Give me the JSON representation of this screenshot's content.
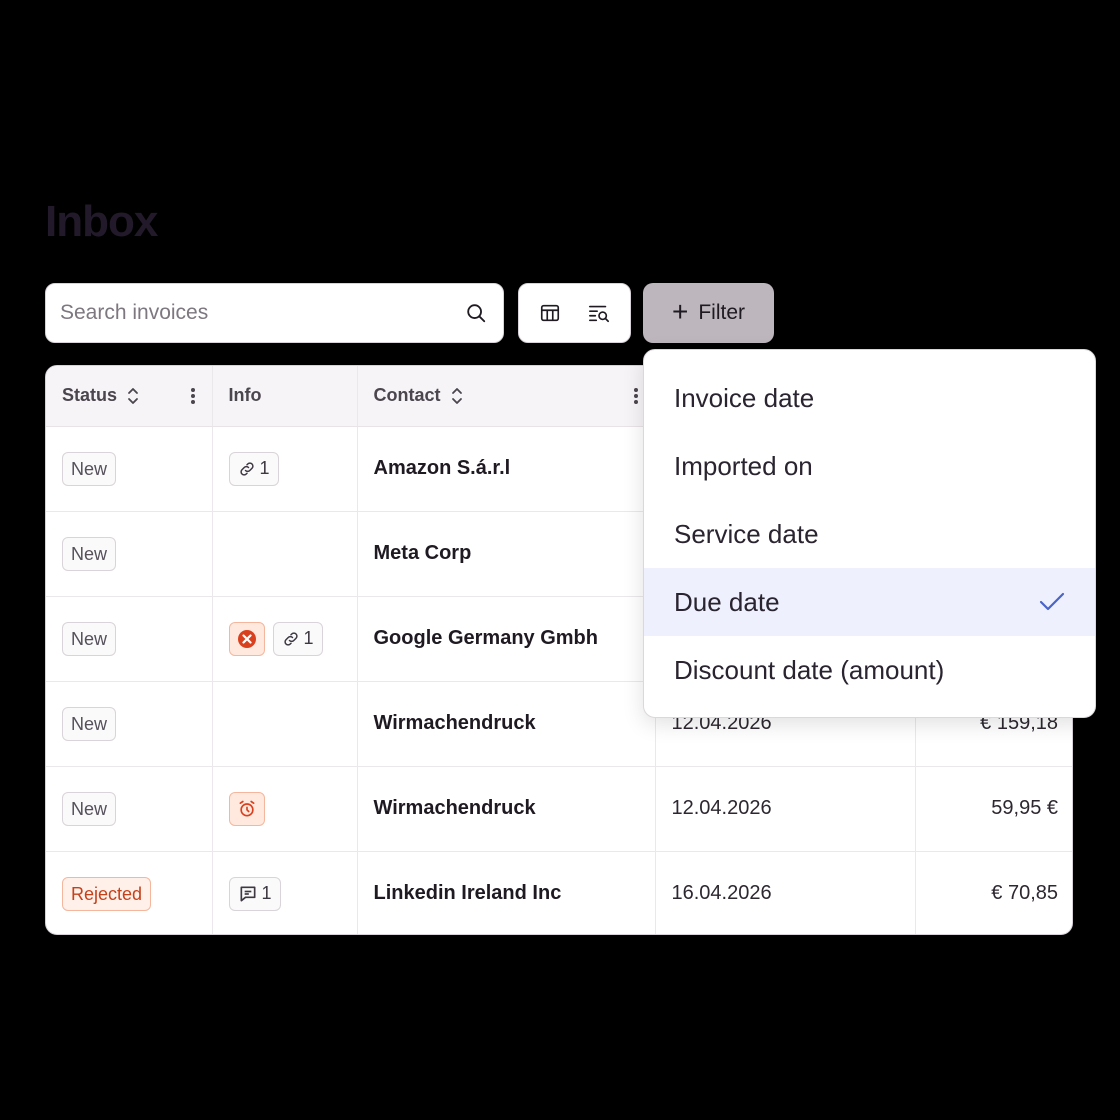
{
  "page": {
    "title": "Inbox"
  },
  "search": {
    "placeholder": "Search invoices"
  },
  "filter": {
    "label": "Filter"
  },
  "table": {
    "headers": {
      "status": "Status",
      "info": "Info",
      "contact": "Contact"
    },
    "rows": [
      {
        "status": "New",
        "info": [
          {
            "icon": "link-icon",
            "count": "1"
          }
        ],
        "contact": "Amazon S.á.r.l",
        "date": "",
        "amount": ""
      },
      {
        "status": "New",
        "info": [],
        "contact": "Meta Corp",
        "date": "",
        "amount": ""
      },
      {
        "status": "New",
        "info": [
          {
            "icon": "error-icon",
            "count": ""
          },
          {
            "icon": "link-icon",
            "count": "1"
          }
        ],
        "contact": "Google Germany Gmbh",
        "date": "",
        "amount": ""
      },
      {
        "status": "New",
        "info": [],
        "contact": "Wirmachendruck",
        "date": "12.04.2026",
        "amount": "€ 159,18"
      },
      {
        "status": "New",
        "info": [
          {
            "icon": "alarm-clock-icon",
            "count": ""
          }
        ],
        "contact": "Wirmachendruck",
        "date": "12.04.2026",
        "amount": "59,95 €"
      },
      {
        "status": "Rejected",
        "info": [
          {
            "icon": "comment-icon",
            "count": "1"
          }
        ],
        "contact": "Linkedin Ireland Inc",
        "date": "16.04.2026",
        "amount": "€ 70,85"
      }
    ]
  },
  "dropdown": {
    "items": [
      {
        "label": "Invoice date",
        "selected": false
      },
      {
        "label": "Imported on",
        "selected": false
      },
      {
        "label": "Service date",
        "selected": false
      },
      {
        "label": "Due date",
        "selected": true
      },
      {
        "label": "Discount date (amount)",
        "selected": false
      }
    ]
  },
  "colors": {
    "accent": "#4a63c9",
    "selected_bg": "#eef0fd",
    "danger": "#d9411e",
    "filter_bg": "#bdb6bd"
  }
}
